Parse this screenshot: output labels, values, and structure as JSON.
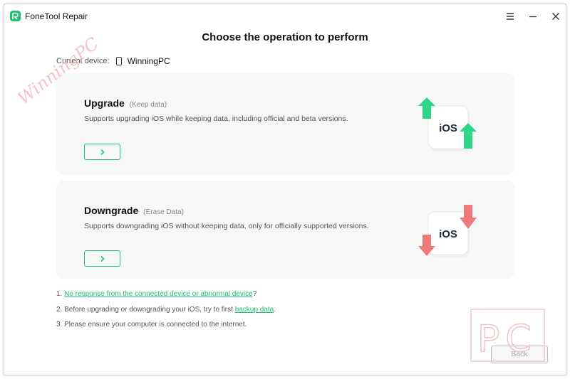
{
  "app": {
    "title": "FoneTool Repair"
  },
  "page": {
    "title": "Choose the operation to perform"
  },
  "device": {
    "label": "Current device:",
    "name": "WinningPC"
  },
  "cards": [
    {
      "title": "Upgrade",
      "subtitle": "(Keep data)",
      "description": "Supports upgrading iOS while keeping data, including official and beta versions.",
      "icon_text": "iOS",
      "arrow_color": "#2fd68a"
    },
    {
      "title": "Downgrade",
      "subtitle": "(Erase Data)",
      "description": "Supports downgrading iOS without keeping data, only for officially supported versions.",
      "icon_text": "iOS",
      "arrow_color": "#f0797a"
    }
  ],
  "notes": {
    "n1_prefix": "1. ",
    "n1_link": "No response from the connected device or abnormal device",
    "n1_suffix": "?",
    "n2_prefix": "2. Before upgrading or downgrading your iOS, try to first ",
    "n2_link": "backup data",
    "n2_suffix": ".",
    "n3": "3. Please ensure your computer is connected to the internet."
  },
  "footer": {
    "back_label": "Back"
  },
  "watermark": {
    "left_text": "WinningPC",
    "right_text": "PC"
  },
  "colors": {
    "accent": "#1dbf73",
    "card_bg": "#f5f8f7"
  }
}
